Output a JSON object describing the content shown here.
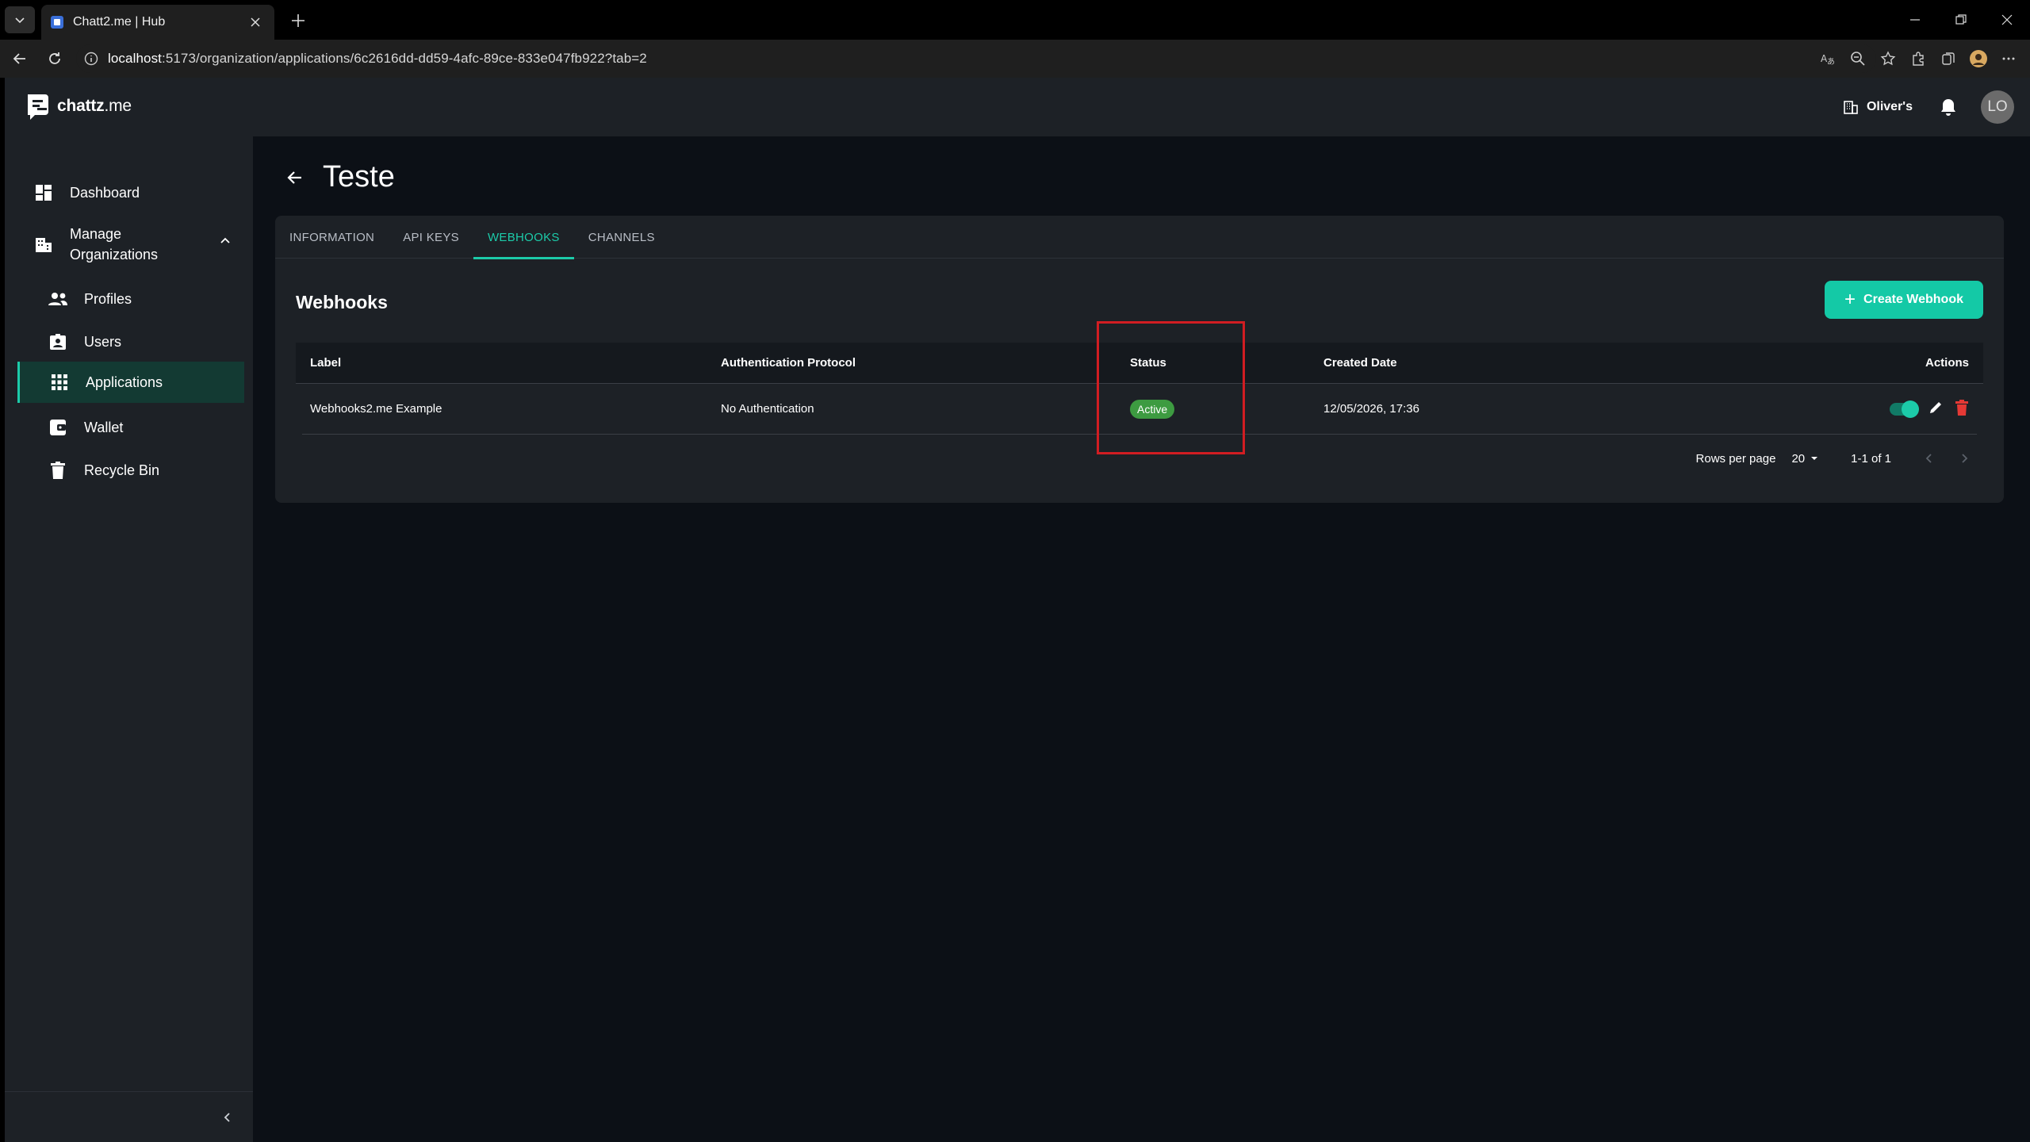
{
  "browser": {
    "tab_title": "Chatt2.me | Hub",
    "url_host": "localhost",
    "url_rest": ":5173/organization/applications/6c2616dd-dd59-4afc-89ce-833e047fb922?tab=2"
  },
  "header": {
    "logo_text_bold": "chattz",
    "logo_text_light": ".me",
    "org_label": "Oliver's",
    "avatar_initials": "LO"
  },
  "sidebar": {
    "items": [
      {
        "label": "Dashboard",
        "icon": "dashboard-icon"
      },
      {
        "label": "Manage Organizations",
        "icon": "building-icon"
      },
      {
        "label": "Profiles",
        "icon": "people-icon"
      },
      {
        "label": "Users",
        "icon": "user-badge-icon"
      },
      {
        "label": "Applications",
        "icon": "apps-grid-icon"
      },
      {
        "label": "Wallet",
        "icon": "wallet-icon"
      },
      {
        "label": "Recycle Bin",
        "icon": "trash-icon"
      }
    ],
    "manage_line1": "Manage",
    "manage_line2": "Organizations",
    "active": "Applications"
  },
  "page": {
    "title": "Teste",
    "tabs": [
      "INFORMATION",
      "API KEYS",
      "WEBHOOKS",
      "CHANNELS"
    ],
    "active_tab": "WEBHOOKS",
    "section_title": "Webhooks",
    "create_button": "Create Webhook"
  },
  "table": {
    "columns": [
      "Label",
      "Authentication Protocol",
      "Status",
      "Created Date",
      "Actions"
    ],
    "rows": [
      {
        "label": "Webhooks2.me Example",
        "auth": "No Authentication",
        "status": "Active",
        "created": "12/05/2026, 17:36",
        "enabled": true
      }
    ]
  },
  "pagination": {
    "rows_per_page_label": "Rows per page",
    "rows_per_page_value": "20",
    "range": "1-1 of 1"
  },
  "colors": {
    "accent": "#1ccba9",
    "status_active": "#3d9b41",
    "delete": "#e53935",
    "highlight": "#d11d22"
  }
}
